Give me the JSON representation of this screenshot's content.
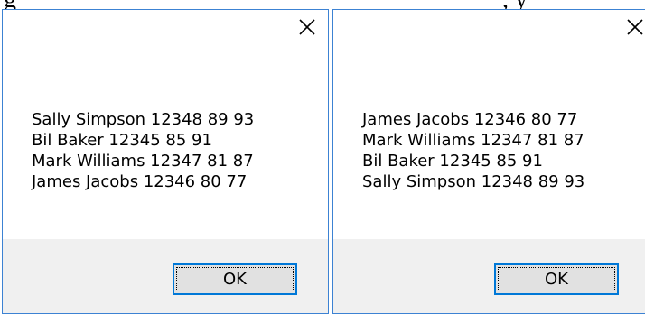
{
  "background_text": {
    "left": "g",
    "right": ", y"
  },
  "dialogs": [
    {
      "lines": [
        "Sally Simpson 12348 89 93",
        "Bil Baker 12345 85 91",
        "Mark Williams 12347 81 87",
        "James Jacobs 12346 80 77"
      ],
      "ok_label": "OK",
      "close_icon": "close-icon"
    },
    {
      "lines": [
        "James Jacobs 12346 80 77",
        "Mark Williams 12347 81 87",
        "Bil Baker 12345 85 91",
        "Sally Simpson 12348 89 93"
      ],
      "ok_label": "OK",
      "close_icon": "close-icon"
    }
  ],
  "colors": {
    "dialog_border": "#3c82d3",
    "footer_bg": "#f0f0f0",
    "button_bg": "#e1e1e1",
    "button_border": "#0078d7"
  }
}
